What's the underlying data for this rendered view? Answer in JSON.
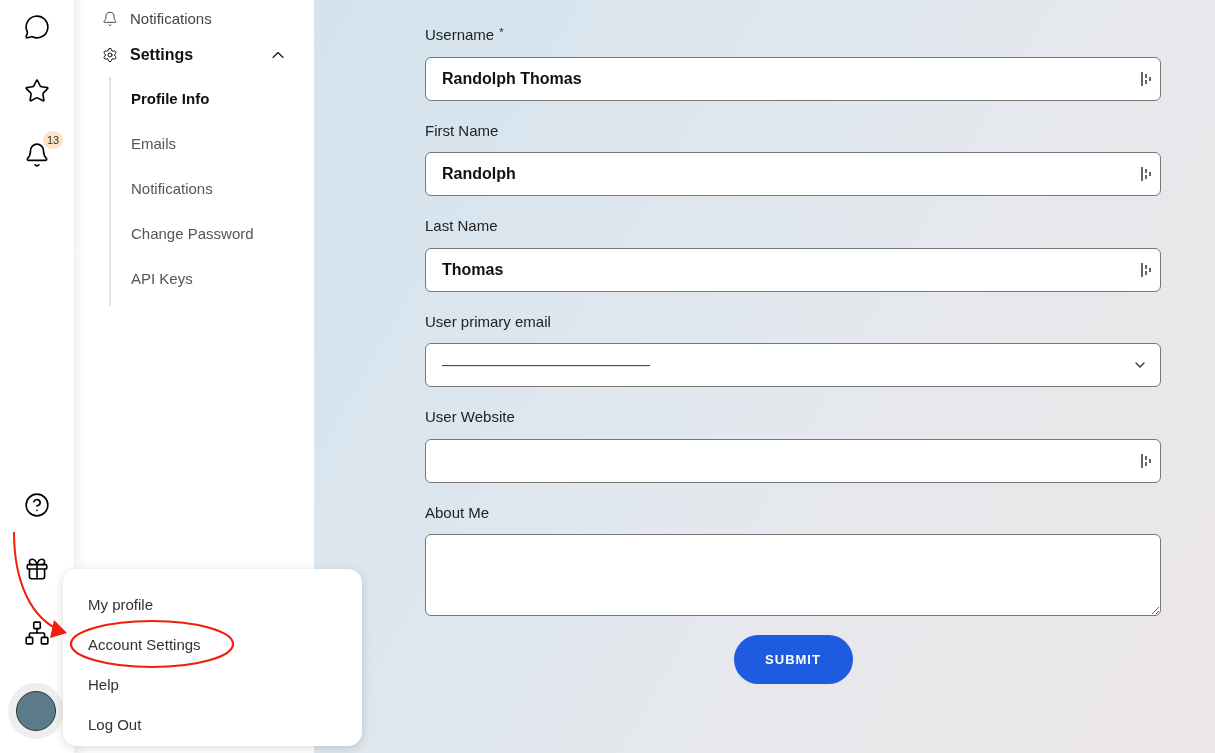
{
  "rail": {
    "items": [
      {
        "kind": "chat"
      },
      {
        "kind": "star"
      },
      {
        "kind": "bell",
        "badge": "13"
      }
    ],
    "bottom": [
      {
        "kind": "help"
      },
      {
        "kind": "gift"
      },
      {
        "kind": "apps"
      }
    ]
  },
  "nav": {
    "top": {
      "label": "Notifications"
    },
    "section": {
      "label": "Settings",
      "expanded": true,
      "children": [
        {
          "label": "Profile Info",
          "selected": true
        },
        {
          "label": "Emails",
          "selected": false
        },
        {
          "label": "Notifications",
          "selected": false
        },
        {
          "label": "Change Password",
          "selected": false
        },
        {
          "label": "API Keys",
          "selected": false
        }
      ]
    }
  },
  "form": {
    "fields": [
      {
        "kind": "text",
        "label": "Username",
        "required_mark": "*",
        "value": "Randolph Thomas"
      },
      {
        "kind": "text",
        "label": "First Name",
        "value": "Randolph"
      },
      {
        "kind": "text",
        "label": "Last Name",
        "value": "Thomas"
      },
      {
        "kind": "select",
        "label": "User primary email",
        "value": "—————————————"
      },
      {
        "kind": "text",
        "label": "User Website"
      },
      {
        "kind": "textarea",
        "label": "About Me"
      }
    ],
    "submit": "SUBMIT"
  },
  "menu": {
    "items": [
      {
        "label": "My profile",
        "highlighted": false
      },
      {
        "label": "Account Settings",
        "highlighted": true
      },
      {
        "label": "Help",
        "highlighted": false
      },
      {
        "label": "Log Out",
        "highlighted": false
      }
    ]
  }
}
